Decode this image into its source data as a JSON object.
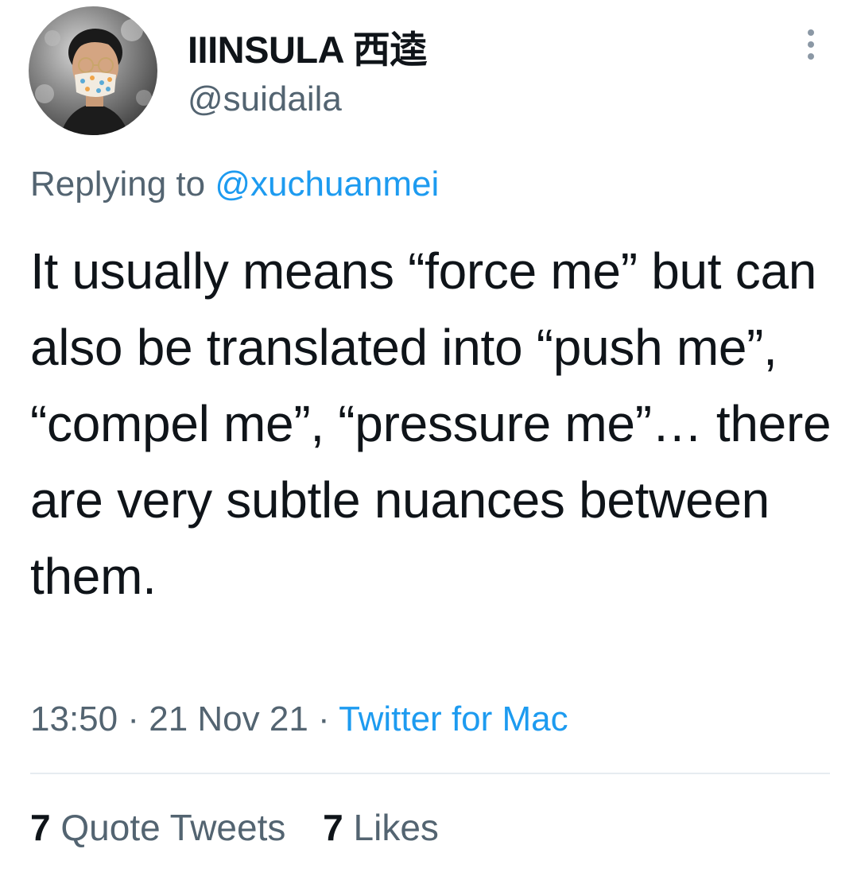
{
  "author": {
    "display_name": "IIINSULA 西逵",
    "handle": "@suidaila",
    "avatar_icon": "user-avatar-photo"
  },
  "more_icon": "more-vertical-icon",
  "reply": {
    "prefix": "Replying to",
    "target": "@xuchuanmei"
  },
  "tweet": {
    "text": "It usually means “force me” but can also be translated into “push me”, “compel me”, “pressure me”… there are very subtle nuances between them."
  },
  "meta": {
    "time": "13:50",
    "separator1": "·",
    "date": "21 Nov 21",
    "separator2": "·",
    "source": "Twitter for Mac"
  },
  "stats": {
    "quote_tweets_count": "7",
    "quote_tweets_label": "Quote Tweets",
    "likes_count": "7",
    "likes_label": "Likes"
  },
  "colors": {
    "link": "#1d9bf0",
    "secondary_text": "#536471",
    "primary_text": "#0f1419",
    "divider": "#e6ecf0"
  }
}
